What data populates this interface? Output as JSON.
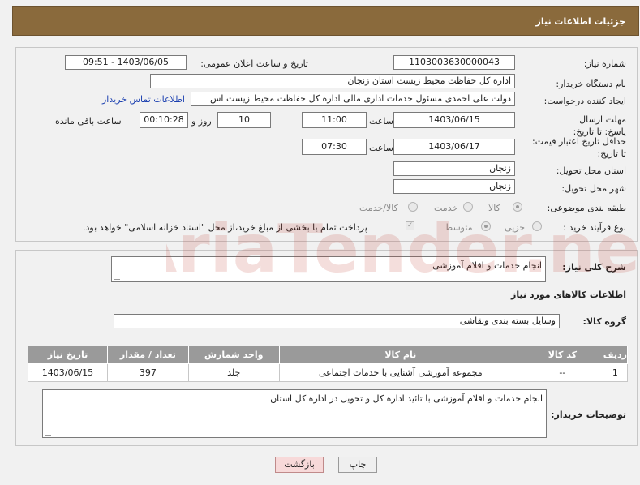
{
  "header": {
    "title": "جزئیات اطلاعات نیاز"
  },
  "form": {
    "need_number_label": "شماره نیاز:",
    "need_number": "1103003630000043",
    "announce_datetime_label": "تاریخ و ساعت اعلان عمومی:",
    "announce_datetime": "1403/06/05 - 09:51",
    "buyer_org_label": "نام دستگاه خریدار:",
    "buyer_org": "اداره کل حفاظت محیط زیست استان زنجان",
    "requester_label": "ایجاد کننده درخواست:",
    "requester": "دولت علی احمدی مسئول خدمات اداری مالی اداره کل حفاظت محیط زیست اس",
    "contact_link": "اطلاعات تماس خریدار",
    "reply_deadline_label": "مهلت ارسال پاسخ: تا تاریخ:",
    "reply_deadline_date": "1403/06/15",
    "time_label": "ساعت",
    "reply_deadline_time": "11:00",
    "days_value": "10",
    "days_label": "روز و",
    "remaining_time": "00:10:28",
    "remaining_label": "ساعت باقی مانده",
    "price_validity_label": "حداقل تاریخ اعتبار قیمت: تا تاریخ:",
    "price_validity_date": "1403/06/17",
    "price_validity_time": "07:30",
    "delivery_province_label": "استان محل تحویل:",
    "delivery_province": "زنجان",
    "delivery_city_label": "شهر محل تحویل:",
    "delivery_city": "زنجان",
    "category_label": "طبقه بندی موضوعی:",
    "category_options": [
      "کالا",
      "خدمت",
      "کالا/خدمت"
    ],
    "process_label": "نوع فرآیند خرید :",
    "process_options": [
      "جزیی",
      "متوسط"
    ],
    "payment_note": "پرداخت تمام یا بخشی از مبلغ خرید،از محل \"اسناد خزانه اسلامی\" خواهد بود."
  },
  "details": {
    "summary_label": "شرح کلی نیاز:",
    "summary": "انجام خدمات و اقلام آموزشی",
    "goods_info_title": "اطلاعات کالاهای مورد نیاز",
    "goods_group_label": "گروه کالا:",
    "goods_group": "وسایل بسته بندی  ونقاشی"
  },
  "table": {
    "headers": [
      "ردیف",
      "کد کالا",
      "نام کالا",
      "واحد شمارش",
      "تعداد / مقدار",
      "تاریخ نیاز"
    ],
    "rows": [
      [
        "1",
        "--",
        "مجموعه آموزشی آشنایی با خدمات اجتماعی",
        "جلد",
        "397",
        "1403/06/15"
      ]
    ]
  },
  "buyer_notes": {
    "label": "توضیحات خریدار:",
    "text": "انجام خدمات و اقلام آموزشی  با تائید اداره کل و تحویل در اداره کل استان"
  },
  "buttons": {
    "print": "چاپ",
    "back": "بازگشت"
  },
  "watermark": {
    "text": "AriaTender.neT"
  },
  "colors": {
    "header": "#8a6a3c",
    "table_header": "#9a9a9a",
    "link": "#1a3fb0"
  }
}
